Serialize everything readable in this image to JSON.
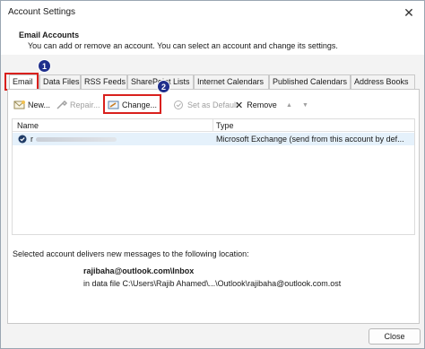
{
  "window": {
    "title": "Account Settings",
    "close_glyph": "✕"
  },
  "header": {
    "title": "Email Accounts",
    "subtitle": "You can add or remove an account. You can select an account and change its settings."
  },
  "tabs": [
    {
      "label": "Email",
      "active": true
    },
    {
      "label": "Data Files"
    },
    {
      "label": "RSS Feeds"
    },
    {
      "label": "SharePoint Lists"
    },
    {
      "label": "Internet Calendars"
    },
    {
      "label": "Published Calendars"
    },
    {
      "label": "Address Books"
    }
  ],
  "annotations": {
    "badge1": "1",
    "badge2": "2",
    "highlight_color": "#d9201d",
    "badge_color": "#1f2f8c"
  },
  "toolbar": {
    "new_label": "New...",
    "repair_label": "Repair...",
    "change_label": "Change...",
    "set_default_label": "Set as Default",
    "remove_label": "Remove",
    "remove_glyph": "✕",
    "up_glyph": "▲",
    "down_glyph": "▼"
  },
  "list": {
    "columns": {
      "name": "Name",
      "type": "Type"
    },
    "rows": [
      {
        "name": "r",
        "type": "Microsoft Exchange (send from this account by def..."
      }
    ]
  },
  "delivery": {
    "label": "Selected account delivers new messages to the following location:",
    "inbox": "rajibaha@outlook.com\\Inbox",
    "datafile": "in data file C:\\Users\\Rajib Ahamed\\...\\Outlook\\rajibaha@outlook.com.ost"
  },
  "footer": {
    "close_label": "Close"
  }
}
